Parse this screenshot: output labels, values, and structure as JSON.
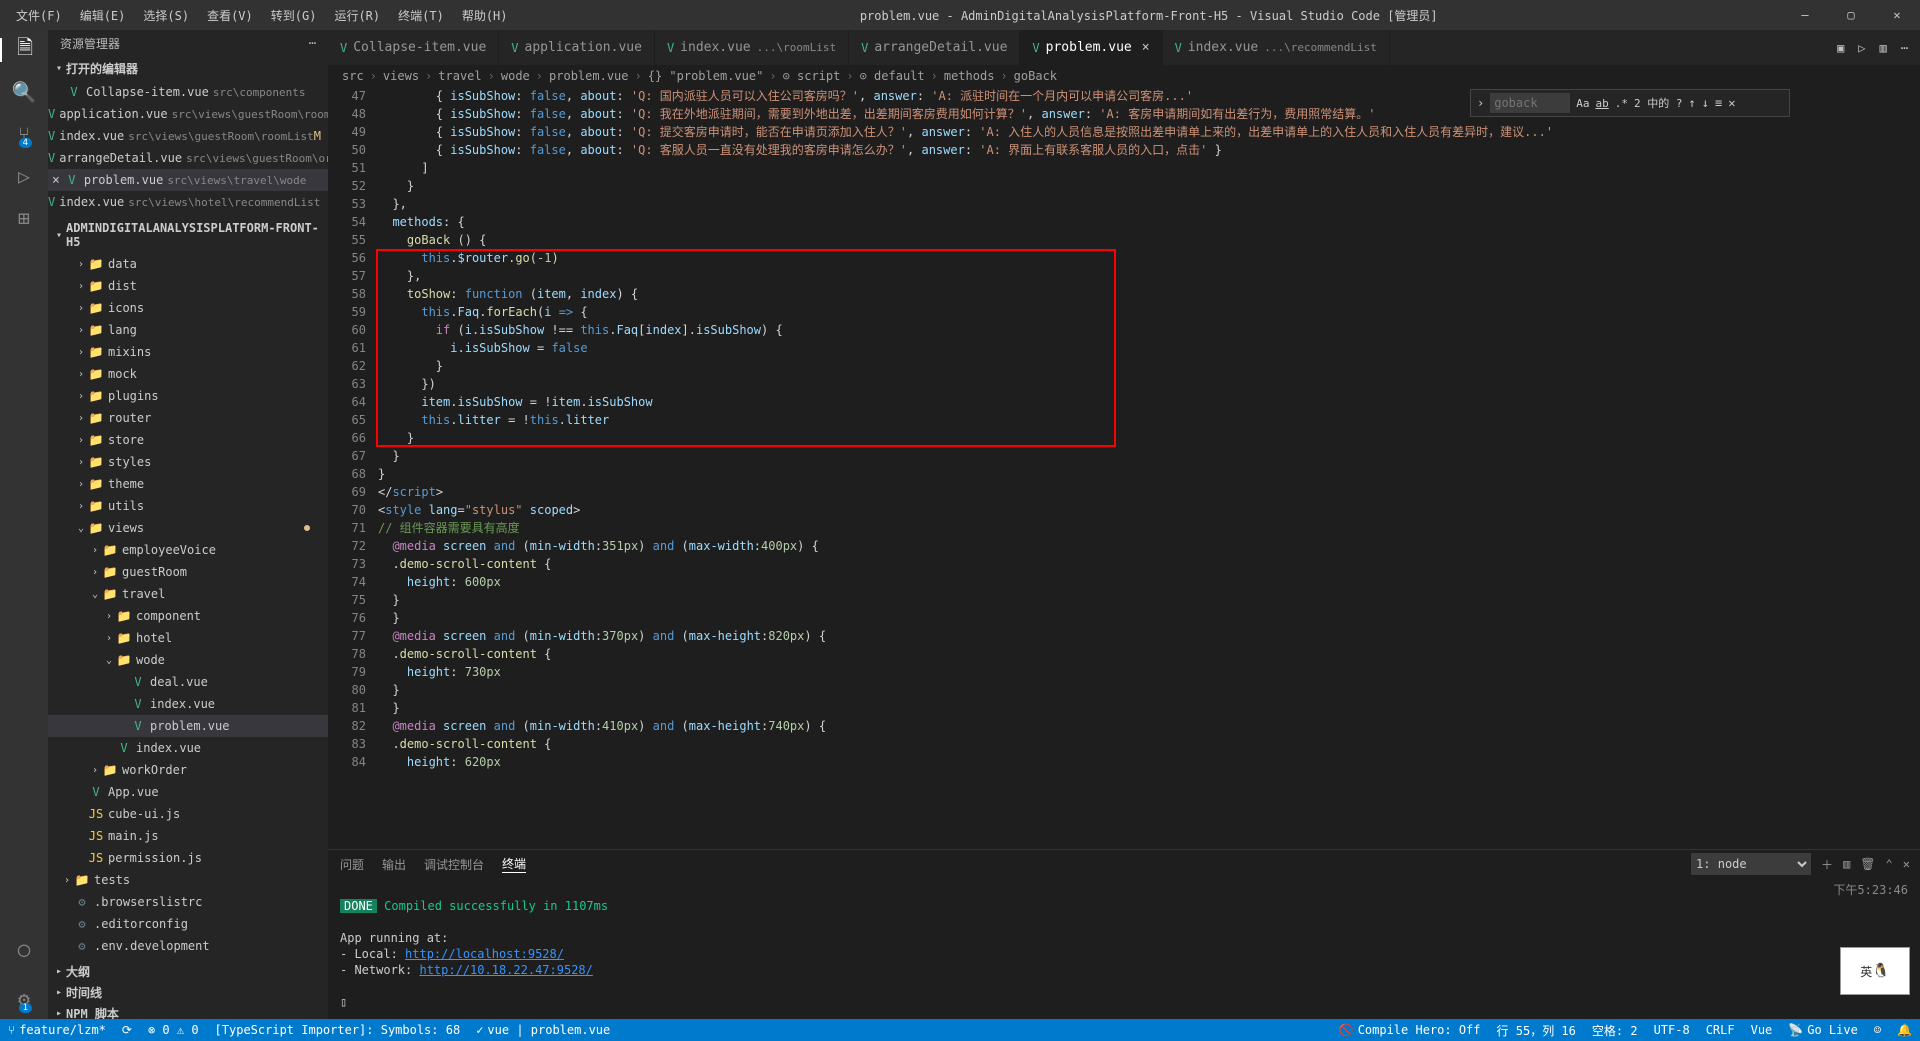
{
  "title": "problem.vue - AdminDigitalAnalysisPlatform-Front-H5 - Visual Studio Code [管理员]",
  "menu": [
    "文件(F)",
    "编辑(E)",
    "选择(S)",
    "查看(V)",
    "转到(G)",
    "运行(R)",
    "终端(T)",
    "帮助(H)"
  ],
  "activity_badges": {
    "scm": "4",
    "ext": "1"
  },
  "side": {
    "title": "资源管理器",
    "open_editors": "打开的编辑器",
    "project": "ADMINDIGITALANALYSISPLATFORM-FRONT-H5",
    "outline": "大纲",
    "timeline": "时间线",
    "npm": "NPM 脚本"
  },
  "open_editors": [
    {
      "icon": "V",
      "name": "Collapse-item.vue",
      "path": "src\\components"
    },
    {
      "icon": "V",
      "name": "application.vue",
      "path": "src\\views\\guestRoom\\roomList",
      "m": "M"
    },
    {
      "icon": "V",
      "name": "index.vue",
      "path": "src\\views\\guestRoom\\roomList",
      "m": "M"
    },
    {
      "icon": "V",
      "name": "arrangeDetail.vue",
      "path": "src\\views\\guestRoom\\order",
      "m": "M"
    },
    {
      "icon": "V",
      "name": "problem.vue",
      "path": "src\\views\\travel\\wode",
      "sel": true,
      "x": true
    },
    {
      "icon": "V",
      "name": "index.vue",
      "path": "src\\views\\hotel\\recommendList"
    }
  ],
  "tree": [
    {
      "d": 1,
      "tw": ">",
      "ic": "fld",
      "n": "data"
    },
    {
      "d": 1,
      "tw": ">",
      "ic": "fld",
      "n": "dist"
    },
    {
      "d": 1,
      "tw": ">",
      "ic": "fld",
      "n": "icons"
    },
    {
      "d": 1,
      "tw": ">",
      "ic": "fld",
      "n": "lang"
    },
    {
      "d": 1,
      "tw": ">",
      "ic": "fld",
      "n": "mixins"
    },
    {
      "d": 1,
      "tw": ">",
      "ic": "fld",
      "n": "mock"
    },
    {
      "d": 1,
      "tw": ">",
      "ic": "fld",
      "n": "plugins"
    },
    {
      "d": 1,
      "tw": ">",
      "ic": "fld",
      "n": "router"
    },
    {
      "d": 1,
      "tw": ">",
      "ic": "fld",
      "n": "store"
    },
    {
      "d": 1,
      "tw": ">",
      "ic": "fld",
      "n": "styles"
    },
    {
      "d": 1,
      "tw": ">",
      "ic": "fld",
      "n": "theme"
    },
    {
      "d": 1,
      "tw": ">",
      "ic": "fld",
      "n": "utils"
    },
    {
      "d": 1,
      "tw": "v",
      "ic": "fld",
      "n": "views",
      "dot": "m"
    },
    {
      "d": 2,
      "tw": ">",
      "ic": "fld",
      "n": "employeeVoice"
    },
    {
      "d": 2,
      "tw": ">",
      "ic": "fld",
      "n": "guestRoom"
    },
    {
      "d": 2,
      "tw": "v",
      "ic": "fld",
      "n": "travel"
    },
    {
      "d": 3,
      "tw": ">",
      "ic": "fld",
      "n": "component"
    },
    {
      "d": 3,
      "tw": ">",
      "ic": "fld",
      "n": "hotel"
    },
    {
      "d": 3,
      "tw": "v",
      "ic": "fld",
      "n": "wode"
    },
    {
      "d": 4,
      "tw": "",
      "ic": "vue",
      "n": "deal.vue"
    },
    {
      "d": 4,
      "tw": "",
      "ic": "vue",
      "n": "index.vue"
    },
    {
      "d": 4,
      "tw": "",
      "ic": "vue",
      "n": "problem.vue",
      "sel": true
    },
    {
      "d": 3,
      "tw": "",
      "ic": "vue",
      "n": "index.vue"
    },
    {
      "d": 2,
      "tw": ">",
      "ic": "fld",
      "n": "workOrder"
    },
    {
      "d": 1,
      "tw": "",
      "ic": "vue",
      "n": "App.vue"
    },
    {
      "d": 1,
      "tw": "",
      "ic": "js",
      "n": "cube-ui.js"
    },
    {
      "d": 1,
      "tw": "",
      "ic": "js",
      "n": "main.js"
    },
    {
      "d": 1,
      "tw": "",
      "ic": "js",
      "n": "permission.js"
    },
    {
      "d": 0,
      "tw": ">",
      "ic": "fld",
      "n": "tests"
    },
    {
      "d": 0,
      "tw": "",
      "ic": "cfg",
      "n": ".browserslistrc"
    },
    {
      "d": 0,
      "tw": "",
      "ic": "cfg",
      "n": ".editorconfig"
    },
    {
      "d": 0,
      "tw": "",
      "ic": "cfg",
      "n": ".env.development"
    }
  ],
  "tabs": [
    {
      "ic": "V",
      "t": "Collapse-item.vue"
    },
    {
      "ic": "V",
      "t": "application.vue"
    },
    {
      "ic": "V",
      "t": "index.vue",
      "s": "...\\roomList"
    },
    {
      "ic": "V",
      "t": "arrangeDetail.vue"
    },
    {
      "ic": "V",
      "t": "problem.vue",
      "act": true,
      "x": true
    },
    {
      "ic": "V",
      "t": "index.vue",
      "s": "...\\recommendList"
    }
  ],
  "crumbs": [
    "src",
    "views",
    "travel",
    "wode",
    "problem.vue",
    "{} \"problem.vue\"",
    "⊙ script",
    "⊙ default",
    "methods",
    "goBack"
  ],
  "find": {
    "ph": "goback",
    "count": "2 中的 ?"
  },
  "code_lines": [
    {
      "n": 47,
      "h": "        { <span class=p>isSubShow</span>: <span class=k>false</span>, <span class=p>about</span>: <span class=s>'Q: 国内派驻人员可以入住公司客房吗？'</span>, <span class=p>answer</span>: <span class=s>'A: 派驻时间在一个月内可以申请公司客房...'</span>"
    },
    {
      "n": 48,
      "h": "        { <span class=p>isSubShow</span>: <span class=k>false</span>, <span class=p>about</span>: <span class=s>'Q: 我在外地派驻期间，需要到外地出差，出差期间客房费用如何计算？'</span>, <span class=p>answer</span>: <span class=s>'A: 客房申请期间如有出差行为，费用照常结算。'</span>"
    },
    {
      "n": 49,
      "h": "        { <span class=p>isSubShow</span>: <span class=k>false</span>, <span class=p>about</span>: <span class=s>'Q: 提交客房申请时，能否在申请页添加入住人？'</span>, <span class=p>answer</span>: <span class=s>'A: 入住人的人员信息是按照出差申请单上来的，出差申请单上的入住人员和入住人员有差异时，建议...'</span>"
    },
    {
      "n": 50,
      "h": "        { <span class=p>isSubShow</span>: <span class=k>false</span>, <span class=p>about</span>: <span class=s>'Q: 客服人员一直没有处理我的客房申请怎么办？'</span>, <span class=p>answer</span>: <span class=s>'A: 界面上有联系客服人员的入口，点击'</span> }"
    },
    {
      "n": 51,
      "h": "      ]"
    },
    {
      "n": 52,
      "h": "    }"
    },
    {
      "n": 53,
      "h": "  },"
    },
    {
      "n": 54,
      "h": "  <span class=p>methods</span>: {"
    },
    {
      "n": 55,
      "h": "    <span class=f>goBack</span> () {"
    },
    {
      "n": 56,
      "h": "      <span class=k>this</span>.<span class=p>$router</span>.<span class=f>go</span>(<span class=n>-1</span>)"
    },
    {
      "n": 57,
      "h": "    },"
    },
    {
      "n": 58,
      "h": "    <span class=f>toShow</span>: <span class=k>function</span> (<span class=p>item</span>, <span class=p>index</span>) {"
    },
    {
      "n": 59,
      "h": "      <span class=k>this</span>.<span class=p>Faq</span>.<span class=f>forEach</span>(<span class=p>i</span> <span class=k>=></span> {"
    },
    {
      "n": 60,
      "h": "        <span class=pk>if</span> (<span class=p>i</span>.<span class=p>isSubShow</span> !== <span class=k>this</span>.<span class=p>Faq</span>[<span class=p>index</span>].<span class=p>isSubShow</span>) {"
    },
    {
      "n": 61,
      "h": "          <span class=p>i</span>.<span class=p>isSubShow</span> = <span class=k>false</span>"
    },
    {
      "n": 62,
      "h": "        }"
    },
    {
      "n": 63,
      "h": "      })"
    },
    {
      "n": 64,
      "h": "      <span class=p>item</span>.<span class=p>isSubShow</span> = !<span class=p>item</span>.<span class=p>isSubShow</span>"
    },
    {
      "n": 65,
      "h": "      <span class=k>this</span>.<span class=p>litter</span> = !<span class=k>this</span>.<span class=p>litter</span>"
    },
    {
      "n": 66,
      "h": "    }"
    },
    {
      "n": 67,
      "h": "  }"
    },
    {
      "n": 68,
      "h": "}"
    },
    {
      "n": 69,
      "h": "&lt;/<span class=k>script</span>&gt;"
    },
    {
      "n": 70,
      "h": "&lt;<span class=k>style</span> <span class=p>lang</span>=<span class=s>\"stylus\"</span> <span class=p>scoped</span>&gt;"
    },
    {
      "n": 71,
      "h": "<span class=c>// 组件容器需要具有高度</span>"
    },
    {
      "n": 72,
      "h": "  <span class=pk>@media</span> <span class=p>screen</span> <span class=k>and</span> (<span class=p>min-width</span>:<span class=n>351px</span>) <span class=k>and</span> (<span class=p>max-width</span>:<span class=n>400px</span>) {"
    },
    {
      "n": 73,
      "h": "  <span class=f>.demo-scroll-content</span> {"
    },
    {
      "n": 74,
      "h": "    <span class=p>height</span>: <span class=n>600px</span>"
    },
    {
      "n": 75,
      "h": "  }"
    },
    {
      "n": 76,
      "h": "  }"
    },
    {
      "n": 77,
      "h": "  <span class=pk>@media</span> <span class=p>screen</span> <span class=k>and</span> (<span class=p>min-width</span>:<span class=n>370px</span>) <span class=k>and</span> (<span class=p>max-height</span>:<span class=n>820px</span>) {"
    },
    {
      "n": 78,
      "h": "  <span class=f>.demo-scroll-content</span> {"
    },
    {
      "n": 79,
      "h": "    <span class=p>height</span>: <span class=n>730px</span>"
    },
    {
      "n": 80,
      "h": "  }"
    },
    {
      "n": 81,
      "h": "  }"
    },
    {
      "n": 82,
      "h": "  <span class=pk>@media</span> <span class=p>screen</span> <span class=k>and</span> (<span class=p>min-width</span>:<span class=n>410px</span>) <span class=k>and</span> (<span class=p>max-height</span>:<span class=n>740px</span>) {"
    },
    {
      "n": 83,
      "h": "  <span class=f>.demo-scroll-content</span> {"
    },
    {
      "n": 84,
      "h": "    <span class=p>height</span>: <span class=n>620px</span>"
    }
  ],
  "term": {
    "tabs": [
      "问题",
      "输出",
      "调试控制台",
      "终端"
    ],
    "dropdown": "1: node",
    "done": "DONE",
    "msg": "Compiled successfully in 1107ms",
    "app": "App running at:",
    "local_l": "- Local:   ",
    "local": "http://localhost:9528/",
    "net_l": "- Network: ",
    "net": "http://10.18.22.47:9528/",
    "time": "下午5:23:46"
  },
  "status": {
    "branch": "feature/lzm*",
    "errs": "⊗ 0  ⚠ 0",
    "ts": "[TypeScript Importer]: Symbols: 68",
    "vue": "vue | problem.vue",
    "hero": "Compile Hero: Off",
    "pos": "行 55，列 16",
    "spaces": "空格: 2",
    "enc": "UTF-8",
    "eol": "CRLF",
    "lang": "Vue",
    "golive": "Go Live"
  },
  "ime": "英"
}
